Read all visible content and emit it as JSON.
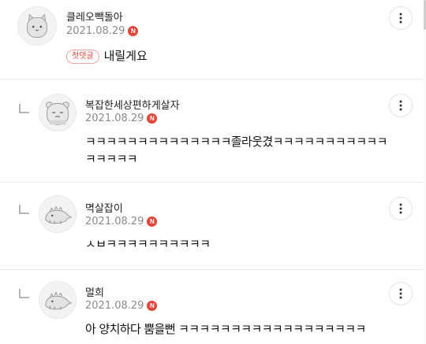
{
  "comments": [
    {
      "nickname": "클레오빽돌아",
      "date": "2021.08.29",
      "new_badge": "N",
      "first_badge": "첫댓글",
      "text": "내릴게요",
      "avatar_icon": "cat-avatar-icon",
      "more_icon": "more-vertical-icon"
    },
    {
      "nickname": "복잡한세상편하게살자",
      "date": "2021.08.29",
      "new_badge": "N",
      "text_line1": "ㅋㅋㅋㅋㅋㅋㅋㅋㅋㅋㅋㅋㅋㅋ졸라웃겼ㅋㅋㅋㅋㅋㅋㅋㅋㅋㅋㅋ",
      "text_line2": "ㅋㅋㅋㅋㅋ",
      "avatar_icon": "sleepy-bear-avatar-icon",
      "reply_icon": "reply-arrow-icon",
      "more_icon": "more-vertical-icon"
    },
    {
      "nickname": "멱살잡이",
      "date": "2021.08.29",
      "new_badge": "N",
      "text": "ㅅㅂㅋㅋㅋㅋㅋㅋㅋㅋㅋㅋ",
      "avatar_icon": "dinosaur-avatar-icon",
      "reply_icon": "reply-arrow-icon",
      "more_icon": "more-vertical-icon"
    },
    {
      "nickname": "멀희",
      "date": "2021.08.29",
      "new_badge": "N",
      "text": "아 양치하다 뿜을뻔 ㅋㅋㅋㅋㅋㅋㅋㅋㅋㅋㅋㅋㅋㅋㅋㅋㅋㅋ",
      "avatar_icon": "dinosaur-avatar-icon",
      "reply_icon": "reply-arrow-icon",
      "more_icon": "more-vertical-icon"
    }
  ],
  "colors": {
    "accent_red": "#e4453a",
    "date_gray": "#8a8a8a",
    "divider": "#e9e9e9"
  }
}
